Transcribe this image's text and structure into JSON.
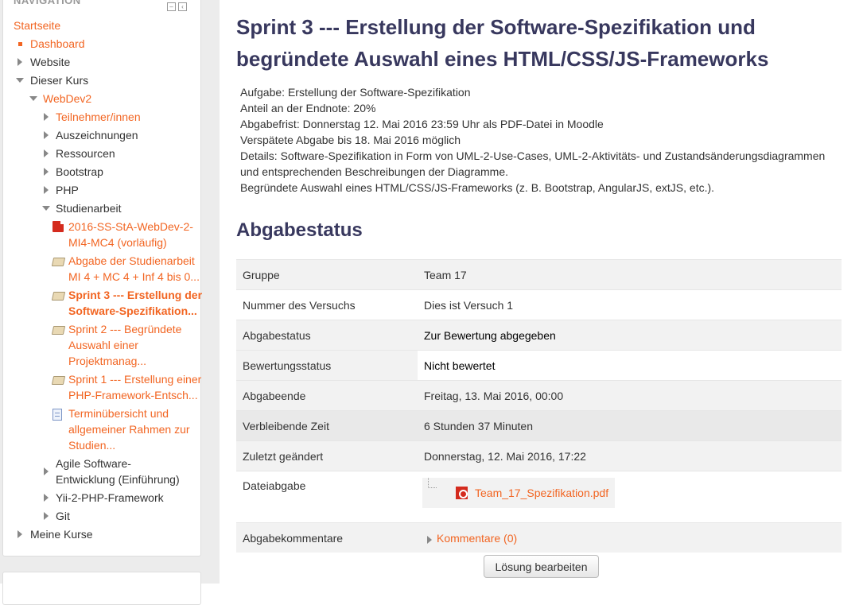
{
  "navigation": {
    "header": "NAVIGATION",
    "items": [
      {
        "label": "Startseite"
      },
      {
        "label": "Dashboard"
      },
      {
        "label": "Website"
      },
      {
        "label": "Dieser Kurs"
      },
      {
        "label": "WebDev2"
      },
      {
        "label": "Teilnehmer/innen"
      },
      {
        "label": "Auszeichnungen"
      },
      {
        "label": "Ressourcen"
      },
      {
        "label": "Bootstrap"
      },
      {
        "label": "PHP"
      },
      {
        "label": "Studienarbeit"
      },
      {
        "label": [
          "2016-SS-StA-WebDev-2-",
          "MI4-MC4 (vorläufig)"
        ]
      },
      {
        "label": [
          "Abgabe der Studienarbeit",
          "MI 4 + MC 4 + Inf 4 bis 0..."
        ]
      },
      {
        "label": [
          "Sprint 3 --- Erstellung der",
          "Software-Spezifikation..."
        ]
      },
      {
        "label": [
          "Sprint 2 --- Begründete",
          "Auswahl einer",
          "Projektmanag..."
        ]
      },
      {
        "label": [
          "Sprint 1 --- Erstellung einer",
          "PHP-Framework-Entsch..."
        ]
      },
      {
        "label": [
          "Terminübersicht und",
          "allgemeiner Rahmen zur",
          "Studien..."
        ]
      },
      {
        "label": [
          "Agile Software-",
          "Entwicklung (Einführung)"
        ]
      },
      {
        "label": "Yii-2-PHP-Framework"
      },
      {
        "label": "Git"
      },
      {
        "label": "Meine Kurse"
      }
    ]
  },
  "page": {
    "title": "Sprint 3 --- Erstellung der Software-Spezifikation und begründete Auswahl eines HTML/CSS/JS-Frameworks",
    "intro": [
      "Aufgabe: Erstellung der Software-Spezifikation",
      "Anteil an der Endnote: 20%",
      "Abgabefrist: Donnerstag 12. Mai 2016 23:59 Uhr als PDF-Datei in Moodle",
      "Verspätete Abgabe bis 18. Mai 2016 möglich",
      "Details: Software-Spezifikation in Form von UML-2-Use-Cases, UML-2-Aktivitäts- und Zustandsänderungsdiagrammen",
      "und entsprechenden Beschreibungen der Diagramme.",
      "Begründete Auswahl eines HTML/CSS/JS-Frameworks (z. B. Bootstrap, AngularJS, extJS, etc.)."
    ]
  },
  "status": {
    "heading": "Abgabestatus",
    "rows": [
      {
        "label": "Gruppe",
        "value": "Team 17"
      },
      {
        "label": "Nummer des Versuchs",
        "value": "Dies ist Versuch 1"
      },
      {
        "label": "Abgabestatus",
        "value": "Zur Bewertung abgegeben"
      },
      {
        "label": "Bewertungsstatus",
        "value": "Nicht bewertet"
      },
      {
        "label": "Abgabeende",
        "value": "Freitag, 13. Mai 2016, 00:00"
      },
      {
        "label": "Verbleibende Zeit",
        "value": "6 Stunden 37 Minuten"
      },
      {
        "label": "Zuletzt geändert",
        "value": "Donnerstag, 12. Mai 2016, 17:22"
      },
      {
        "label": "Dateiabgabe",
        "value": "Team_17_Spezifikation.pdf"
      },
      {
        "label": "Abgabekommentare",
        "value": "Kommentare (0)"
      }
    ]
  },
  "actions": {
    "edit_label": "Lösung bearbeiten"
  },
  "colors": {
    "link": "#f26522",
    "heading": "#38385e"
  }
}
